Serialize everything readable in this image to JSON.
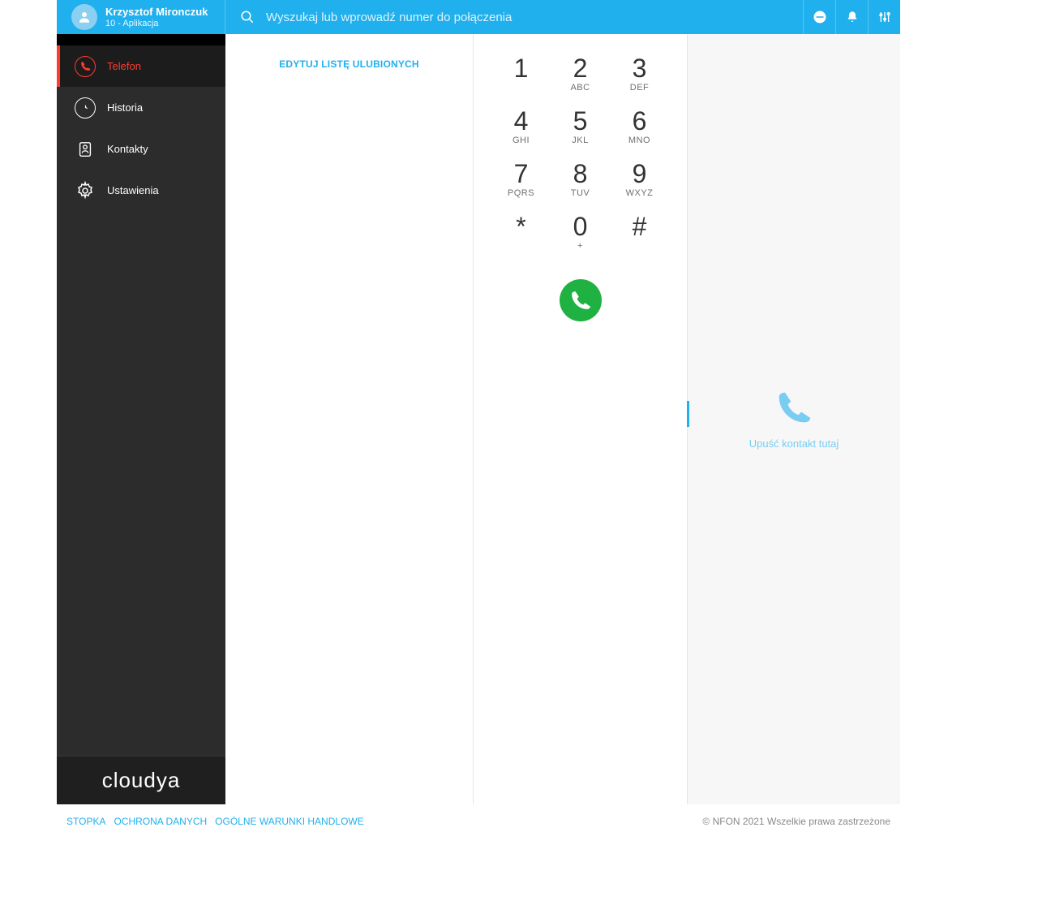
{
  "header": {
    "user": {
      "name": "Krzysztof Mironczuk",
      "subtitle": "10 - Aplikacja"
    },
    "search_placeholder": "Wyszukaj lub wprowadź numer do połączenia"
  },
  "sidebar": {
    "items": [
      {
        "label": "Telefon",
        "active": true
      },
      {
        "label": "Historia",
        "active": false
      },
      {
        "label": "Kontakty",
        "active": false
      },
      {
        "label": "Ustawienia",
        "active": false
      }
    ],
    "logo": "cloudya"
  },
  "favorites": {
    "edit_label": "EDYTUJ LISTĘ ULUBIONYCH"
  },
  "dialpad": {
    "keys": [
      {
        "digit": "1",
        "letters": ""
      },
      {
        "digit": "2",
        "letters": "ABC"
      },
      {
        "digit": "3",
        "letters": "DEF"
      },
      {
        "digit": "4",
        "letters": "GHI"
      },
      {
        "digit": "5",
        "letters": "JKL"
      },
      {
        "digit": "6",
        "letters": "MNO"
      },
      {
        "digit": "7",
        "letters": "PQRS"
      },
      {
        "digit": "8",
        "letters": "TUV"
      },
      {
        "digit": "9",
        "letters": "WXYZ"
      },
      {
        "digit": "*",
        "letters": ""
      },
      {
        "digit": "0",
        "letters": "+"
      },
      {
        "digit": "#",
        "letters": ""
      }
    ]
  },
  "drop_area": {
    "hint": "Upuść kontakt tutaj"
  },
  "footer": {
    "links": [
      "STOPKA",
      "OCHRONA DANYCH",
      "OGÓLNE WARUNKI HANDLOWE"
    ],
    "copyright": "© NFON 2021 Wszelkie prawa zastrzeżone"
  }
}
